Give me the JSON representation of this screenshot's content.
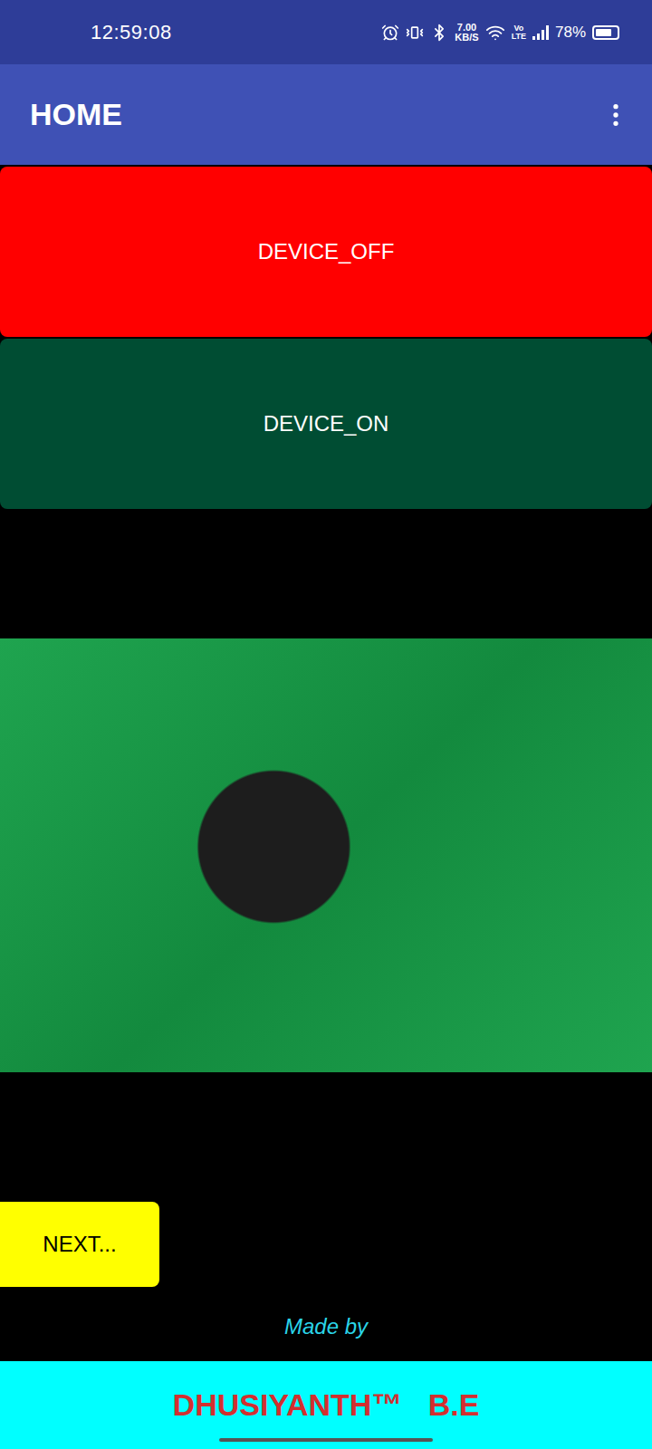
{
  "status_bar": {
    "time": "12:59:08",
    "speed_value": "7.00",
    "speed_unit": "KB/S",
    "network_top": "Vo",
    "network_bottom": "LTE",
    "battery": "78%",
    "battery_level": 0.78
  },
  "app_bar": {
    "title": "HOME"
  },
  "buttons": [
    {
      "label": "DEVICE_OFF",
      "color": "#ff0000"
    },
    {
      "label": "DEVICE_ON",
      "color": "#004d33"
    }
  ],
  "next_button": {
    "label": "NEXT..."
  },
  "credit": {
    "caption": "Made by",
    "author": "DHUSIYANTH™   B.E"
  }
}
